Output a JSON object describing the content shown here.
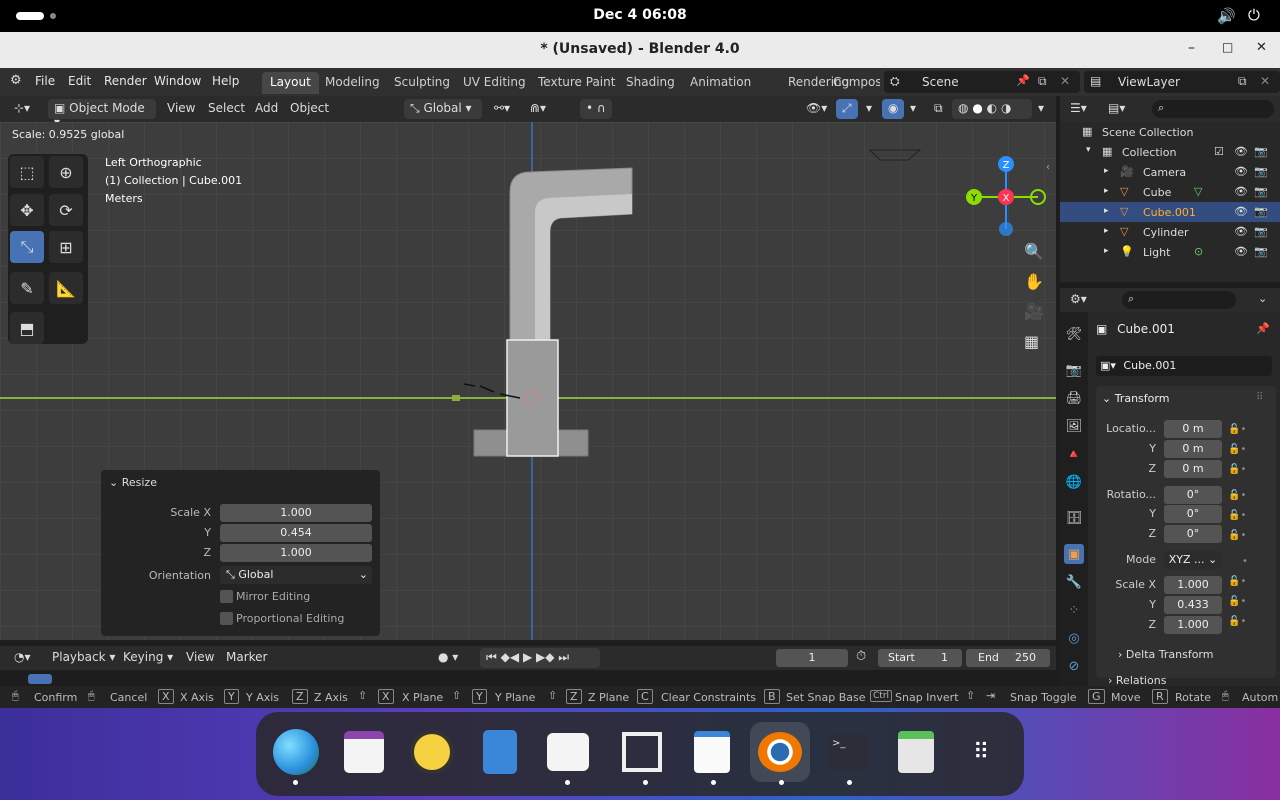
{
  "system_bar": {
    "datetime": "Dec 4  06:08"
  },
  "window": {
    "title": "* (Unsaved) - Blender 4.0",
    "minimize": "–",
    "maximize": "□",
    "close": "✕"
  },
  "menu": {
    "file": "File",
    "edit": "Edit",
    "render": "Render",
    "window": "Window",
    "help": "Help"
  },
  "workspaces": [
    "Layout",
    "Modeling",
    "Sculpting",
    "UV Editing",
    "Texture Paint",
    "Shading",
    "Animation",
    "Rendering",
    "Compos"
  ],
  "scene": {
    "label": "Scene",
    "viewlayer": "ViewLayer"
  },
  "viewport_header": {
    "mode": "Object Mode",
    "view": "View",
    "select": "Select",
    "add": "Add",
    "object": "Object",
    "orientation": "Global"
  },
  "viewport": {
    "scale_readout": "Scale: 0.9525 global",
    "view_name": "Left Orthographic",
    "collection_info": "(1) Collection | Cube.001",
    "units": "Meters"
  },
  "gizmo": {
    "z": "Z",
    "y": "Y",
    "x": "X"
  },
  "resize_panel": {
    "title": "Resize",
    "scale_x_label": "Scale X",
    "scale_x": "1.000",
    "y_label": "Y",
    "y": "0.454",
    "z_label": "Z",
    "z": "1.000",
    "orientation_label": "Orientation",
    "orientation": "Global",
    "mirror": "Mirror Editing",
    "proportional": "Proportional Editing"
  },
  "timeline": {
    "playback": "Playback",
    "keying": "Keying",
    "view": "View",
    "marker": "Marker",
    "current_frame": "1",
    "start_label": "Start",
    "start": "1",
    "end_label": "End",
    "end": "250"
  },
  "status": {
    "confirm": "Confirm",
    "cancel": "Cancel",
    "x_key": "X",
    "x_axis": "X Axis",
    "y_key": "Y",
    "y_axis": "Y Axis",
    "z_key": "Z",
    "z_axis": "Z Axis",
    "x_plane": "X Plane",
    "y_plane": "Y Plane",
    "z_plane": "Z Plane",
    "c_key": "C",
    "clear": "Clear Constraints",
    "b_key": "B",
    "snap_base": "Set Snap Base",
    "ctrl_key": "Ctrl",
    "snap_invert": "Snap Invert",
    "snap_toggle": "Snap Toggle",
    "g_key": "G",
    "move": "Move",
    "r_key": "R",
    "rotate": "Rotate",
    "auto": "Autom"
  },
  "outliner": {
    "root": "Scene Collection",
    "collection": "Collection",
    "items": [
      "Camera",
      "Cube",
      "Cube.001",
      "Cylinder",
      "Light"
    ]
  },
  "properties": {
    "object_name": "Cube.001",
    "data_name": "Cube.001",
    "transform": "Transform",
    "location_label": "Locatio...",
    "loc_x": "0 m",
    "loc_y": "0 m",
    "loc_z": "0 m",
    "rotation_label": "Rotatio...",
    "rot_x": "0°",
    "rot_y": "0°",
    "rot_z": "0°",
    "mode_label": "Mode",
    "mode": "XYZ ...",
    "scale_label": "Scale X",
    "scale_x": "1.000",
    "scale_y": "0.433",
    "scale_z": "1.000",
    "y_label": "Y",
    "z_label": "Z",
    "delta": "Delta Transform",
    "relations": "Relations"
  },
  "colors": {
    "accent": "#4772b3",
    "selected_row": "#334d80",
    "x_axis": "#ff3352",
    "y_axis": "#8bdc00",
    "z_axis": "#2890ff"
  }
}
